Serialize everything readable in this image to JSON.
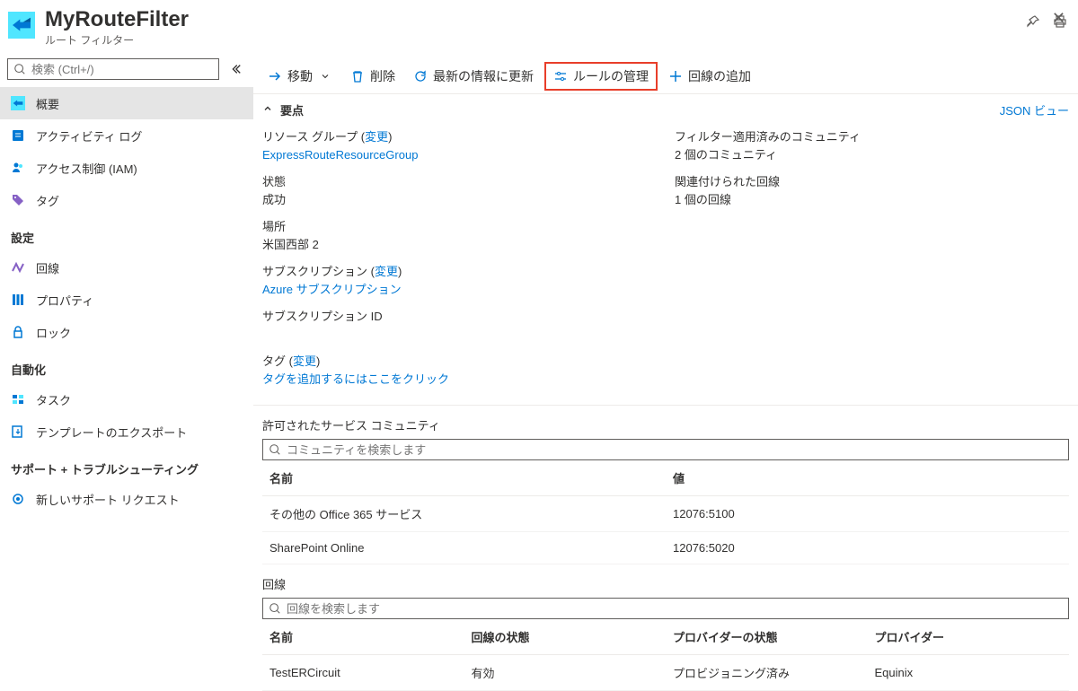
{
  "header": {
    "title": "MyRouteFilter",
    "subtitle": "ルート フィルター"
  },
  "sidebar": {
    "search_placeholder": "検索 (Ctrl+/)",
    "items_top": [
      {
        "label": "概要",
        "icon": "route-filter",
        "active": true
      },
      {
        "label": "アクティビティ ログ",
        "icon": "activity-log"
      },
      {
        "label": "アクセス制御 (IAM)",
        "icon": "access-control"
      },
      {
        "label": "タグ",
        "icon": "tag"
      }
    ],
    "section_settings": "設定",
    "items_settings": [
      {
        "label": "回線",
        "icon": "circuit"
      },
      {
        "label": "プロパティ",
        "icon": "properties"
      },
      {
        "label": "ロック",
        "icon": "lock"
      }
    ],
    "section_automation": "自動化",
    "items_automation": [
      {
        "label": "タスク",
        "icon": "tasks"
      },
      {
        "label": "テンプレートのエクスポート",
        "icon": "export-template"
      }
    ],
    "section_support": "サポート + トラブルシューティング",
    "items_support": [
      {
        "label": "新しいサポート リクエスト",
        "icon": "support"
      }
    ]
  },
  "toolbar": {
    "move": "移動",
    "delete": "削除",
    "refresh": "最新の情報に更新",
    "manage_rules": "ルールの管理",
    "add_circuit": "回線の追加"
  },
  "essentials": {
    "title": "要点",
    "json_view": "JSON ビュー",
    "change": "変更",
    "left": {
      "rg_label": "リソース グループ",
      "rg_value": "ExpressRouteResourceGroup",
      "state_label": "状態",
      "state_value": "成功",
      "location_label": "場所",
      "location_value": "米国西部 2",
      "sub_label": "サブスクリプション",
      "sub_value": "Azure サブスクリプション",
      "subid_label": "サブスクリプション ID",
      "tags_label": "タグ",
      "tags_link": "タグを追加するにはここをクリック"
    },
    "right": {
      "communities_label": "フィルター適用済みのコミュニティ",
      "communities_value": "2 個のコミュニティ",
      "circuits_label": "関連付けられた回線",
      "circuits_value": "1 個の回線"
    }
  },
  "communities_section": {
    "title": "許可されたサービス コミュニティ",
    "filter_placeholder": "コミュニティを検索します",
    "col_name": "名前",
    "col_value": "値",
    "rows": [
      {
        "name": "その他の Office 365 サービス",
        "value": "12076:5100"
      },
      {
        "name": "SharePoint Online",
        "value": "12076:5020"
      }
    ]
  },
  "circuits_section": {
    "title": "回線",
    "filter_placeholder": "回線を検索します",
    "col_name": "名前",
    "col_state": "回線の状態",
    "col_provider_state": "プロバイダーの状態",
    "col_provider": "プロバイダー",
    "rows": [
      {
        "name": "TestERCircuit",
        "state": "有効",
        "provider_state": "プロビジョニング済み",
        "provider": "Equinix"
      }
    ]
  }
}
